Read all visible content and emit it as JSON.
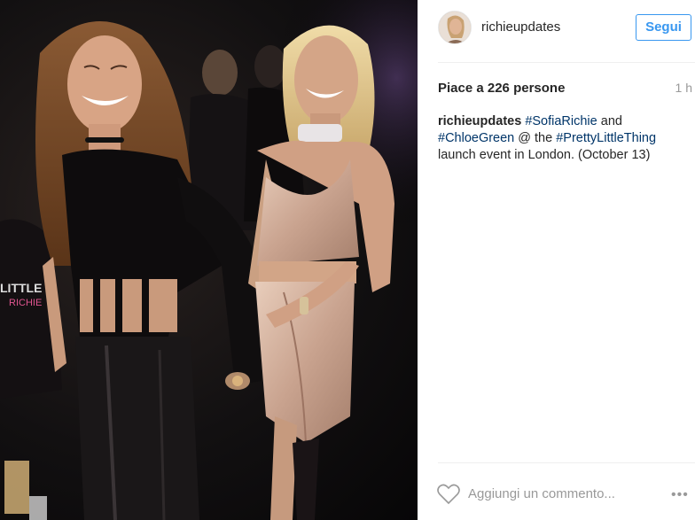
{
  "post": {
    "username": "richieupdates",
    "follow_label": "Segui",
    "likes_text": "Piace a 226 persone",
    "time_ago": "1 h",
    "caption": {
      "user": "richieupdates",
      "tag1": "#SofiaRichie",
      "text1": " and ",
      "tag2": "#ChloeGreen",
      "text2": " @ the ",
      "tag3": "#PrettyLittleThing",
      "text3": " launch event in London. (October 13)"
    },
    "comment_placeholder": "Aggiungi un commento...",
    "more_label": "•••"
  },
  "colors": {
    "accent": "#3897f0",
    "hashtag": "#003569",
    "muted": "#999999",
    "text": "#262626"
  },
  "icons": [
    "heart-icon",
    "more-options-icon",
    "avatar"
  ]
}
